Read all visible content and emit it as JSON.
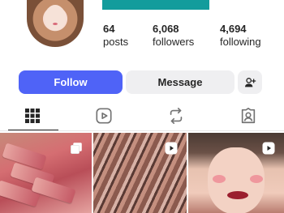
{
  "profile": {
    "stats": {
      "posts": {
        "count": "64",
        "label": "posts"
      },
      "followers": {
        "count": "6,068",
        "label": "followers"
      },
      "following": {
        "count": "4,694",
        "label": "following"
      }
    }
  },
  "actions": {
    "follow_label": "Follow",
    "message_label": "Message",
    "add_user_icon": "person-add-icon"
  },
  "tabs": [
    {
      "icon": "grid-icon",
      "active": true
    },
    {
      "icon": "reels-icon",
      "active": false
    },
    {
      "icon": "reposts-icon",
      "active": false
    },
    {
      "icon": "tagged-icon",
      "active": false
    }
  ],
  "posts": [
    {
      "type": "carousel",
      "badge_icon": "carousel-icon"
    },
    {
      "type": "reel",
      "badge_icon": "play-icon"
    },
    {
      "type": "reel",
      "badge_icon": "play-icon"
    }
  ],
  "colors": {
    "follow_button": "#4f63f7",
    "banner": "#139c9c",
    "secondary_button": "#efeff1"
  }
}
